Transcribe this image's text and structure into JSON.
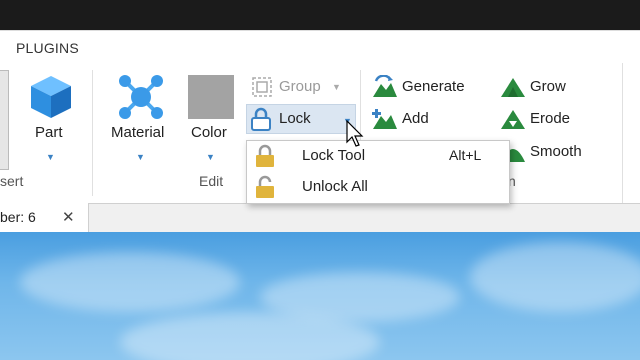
{
  "menubar": {
    "tab": "PLUGINS"
  },
  "ribbon": {
    "insert": {
      "part_label": "Part",
      "caption": "sert"
    },
    "edit": {
      "material_label": "Material",
      "color_label": "Color",
      "caption": "Edit",
      "group_label": "Group",
      "lock_label": "Lock"
    },
    "terrain": {
      "generate_label": "Generate",
      "add_label": "Add",
      "grow_label": "Grow",
      "erode_label": "Erode",
      "smooth_label": "Smooth",
      "caption_partial": "n"
    }
  },
  "lock_menu": {
    "items": [
      {
        "label": "Lock Tool",
        "shortcut": "Alt+L"
      },
      {
        "label": "Unlock All",
        "shortcut": ""
      }
    ]
  },
  "document_tab": {
    "label": "ber: 6",
    "close": "✕"
  },
  "colors": {
    "accent": "#3b82c4",
    "terrain_green": "#2a8a3e",
    "lock_gold": "#e0b43c"
  }
}
